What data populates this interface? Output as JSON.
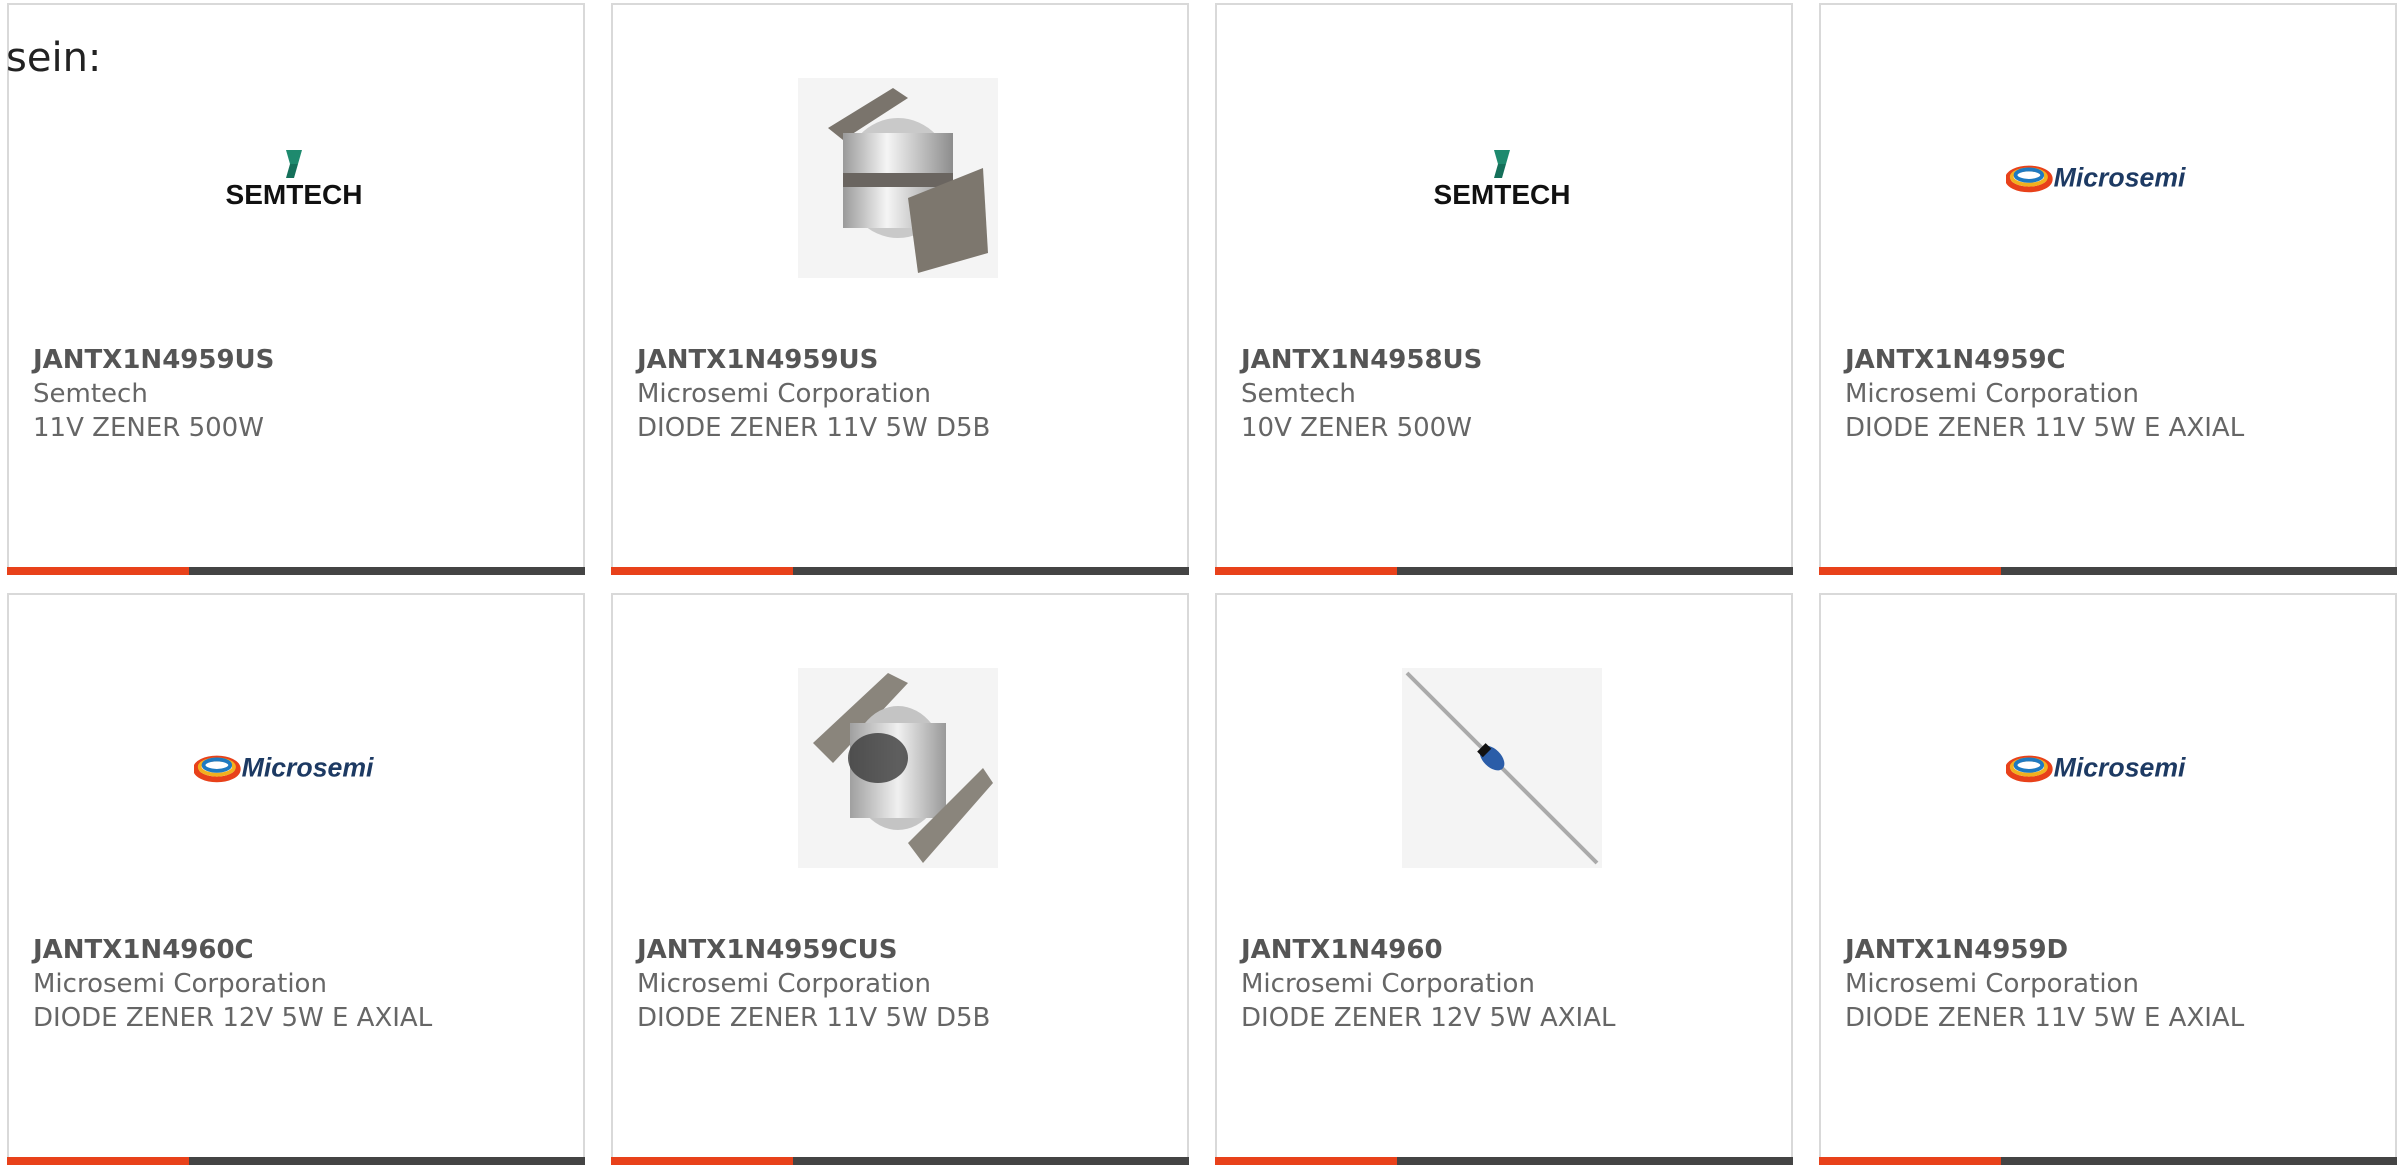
{
  "heading": "sein:",
  "colors": {
    "accent": "#e8411a",
    "bar": "#444444"
  },
  "products": [
    {
      "part_number": "JANTX1N4959US",
      "manufacturer": "Semtech",
      "description": "11V ZENER 500W",
      "image": "semtech-logo"
    },
    {
      "part_number": "JANTX1N4959US",
      "manufacturer": "Microsemi Corporation",
      "description": "DIODE ZENER 11V 5W D5B",
      "image": "smd-diode-photo"
    },
    {
      "part_number": "JANTX1N4958US",
      "manufacturer": "Semtech",
      "description": "10V ZENER 500W",
      "image": "semtech-logo"
    },
    {
      "part_number": "JANTX1N4959C",
      "manufacturer": "Microsemi Corporation",
      "description": "DIODE ZENER 11V 5W E AXIAL",
      "image": "microsemi-logo"
    },
    {
      "part_number": "JANTX1N4960C",
      "manufacturer": "Microsemi Corporation",
      "description": "DIODE ZENER 12V 5W E AXIAL",
      "image": "microsemi-logo"
    },
    {
      "part_number": "JANTX1N4959CUS",
      "manufacturer": "Microsemi Corporation",
      "description": "DIODE ZENER 11V 5W D5B",
      "image": "melf-diode-photo"
    },
    {
      "part_number": "JANTX1N4960",
      "manufacturer": "Microsemi Corporation",
      "description": "DIODE ZENER 12V 5W AXIAL",
      "image": "axial-diode-photo"
    },
    {
      "part_number": "JANTX1N4959D",
      "manufacturer": "Microsemi Corporation",
      "description": "DIODE ZENER 11V 5W E AXIAL",
      "image": "microsemi-logo"
    }
  ],
  "logos": {
    "semtech": "SEMTECH",
    "microsemi": "Microsemi"
  }
}
